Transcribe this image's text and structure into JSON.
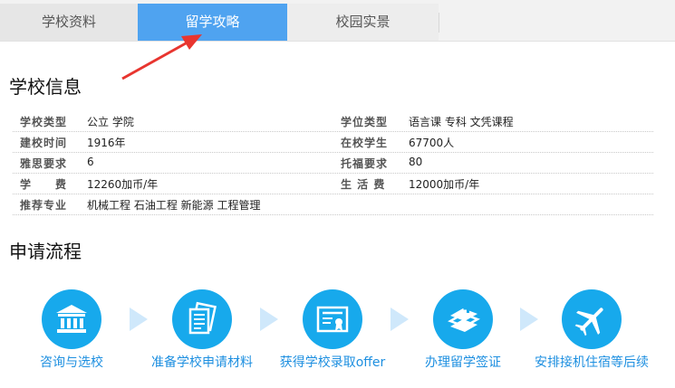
{
  "tabs": [
    {
      "label": "学校资料"
    },
    {
      "label": "留学攻略"
    },
    {
      "label": "校园实景"
    }
  ],
  "school_info": {
    "title": "学校信息",
    "rows": [
      {
        "left_label": "学校类型",
        "left_value": "公立 学院",
        "right_label": "学位类型",
        "right_value": "语言课 专科 文凭课程"
      },
      {
        "left_label": "建校时间",
        "left_value": "1916年",
        "right_label": "在校学生",
        "right_value": "67700人"
      },
      {
        "left_label": "雅思要求",
        "left_value": "6",
        "right_label": "托福要求",
        "right_value": "80"
      },
      {
        "left_label": "学　　费",
        "left_value": "12260加币/年",
        "right_label": "生 活 费",
        "right_value": "12000加币/年"
      },
      {
        "left_label": "推荐专业",
        "left_value": "机械工程 石油工程 新能源 工程管理"
      }
    ]
  },
  "process": {
    "title": "申请流程",
    "steps": [
      {
        "label": "咨询与选校",
        "icon": "institution-icon"
      },
      {
        "label": "准备学校申请材料",
        "icon": "documents-icon"
      },
      {
        "label": "获得学校录取offer",
        "icon": "certificate-icon"
      },
      {
        "label": "办理留学签证",
        "icon": "books-icon"
      },
      {
        "label": "安排接机住宿等后续",
        "icon": "airplane-icon"
      }
    ]
  },
  "colors": {
    "active_tab": "#4fa3f0",
    "step_circle": "#17a9ec",
    "step_text": "#1d8fe0",
    "arrow": "#e8352f"
  }
}
